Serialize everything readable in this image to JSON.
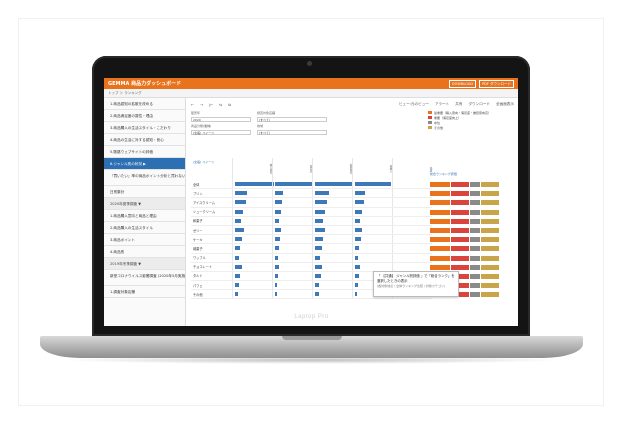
{
  "laptop": {
    "brand": "Laptop Pro"
  },
  "app": {
    "title": "GEMMA 商品力ダッシュボード",
    "buttons": [
      "DOWNLOAD",
      "PDF ダウンロード"
    ],
    "breadcrumb": "トップ ＞ ランキング"
  },
  "sidebar": {
    "items": [
      {
        "label": "1.商品認知の拡散を改める",
        "type": "normal"
      },
      {
        "label": "2.商品満足度の属性・理由",
        "type": "normal"
      },
      {
        "label": "3.商品購入の生活スタイル・こだわり",
        "type": "normal"
      },
      {
        "label": "4.商品の生活に対する認知・良心",
        "type": "normal"
      },
      {
        "label": "5.販路ウェブサイトの評価",
        "type": "normal"
      },
      {
        "label": "6.ジャンル別の状況 ▶",
        "type": "active"
      },
      {
        "label": "『買いたい』率の商品ポイント分析と買わない理由のポイント",
        "type": "tall"
      },
      {
        "label": "日別集計",
        "type": "normal"
      },
      {
        "label": "2020年夏季調査 ▼",
        "type": "section"
      },
      {
        "label": "1.商品購入意向と商品と理由",
        "type": "normal"
      },
      {
        "label": "2.商品購入の生活スタイル",
        "type": "normal"
      },
      {
        "label": "3.商品ポイント",
        "type": "normal"
      },
      {
        "label": "4.商品別",
        "type": "normal"
      },
      {
        "label": "2019年冬季調査 ▼",
        "type": "section"
      },
      {
        "label": "新型コロナウイルス影響調査 (2020年5月実施)",
        "type": "tall"
      },
      {
        "label": "1.調査対象店舗",
        "type": "normal"
      }
    ]
  },
  "toolbar": {
    "left": [
      "←",
      "→",
      "|←",
      "⇆",
      "⧉"
    ],
    "right": [
      "ビュー:元のビュー",
      "アラート",
      "共有",
      "ダウンロード",
      "全画面表示"
    ]
  },
  "filters": [
    {
      "label": "販売年",
      "value": "2020"
    },
    {
      "label": "調査対象店舗",
      "value": "(すべて)"
    },
    {
      "label": "商品分類(業種)",
      "value": "(全般) スイーツ"
    },
    {
      "label": "地域",
      "value": "(すべて)"
    }
  ],
  "legend": [
    {
      "label": "最重要（購入意向・満足度・推奨意向高）",
      "color": "#e8731c"
    },
    {
      "label": "重要（満足度向上）",
      "color": "#d9453d"
    },
    {
      "label": "中位",
      "color": "#8a8a8a"
    },
    {
      "label": "その他",
      "color": "#c9a54a"
    }
  ],
  "grid": {
    "header_label": "(全般) スイーツ",
    "columns": [
      "購入意向",
      "満足度",
      "推奨意向",
      "再購入",
      "価格"
    ],
    "rows": [
      {
        "label": "全体",
        "values": [
          0.95,
          0.9,
          0.92,
          0.88,
          0.0
        ]
      },
      {
        "label": "プリン",
        "values": [
          0.3,
          0.2,
          0.35,
          0.25,
          0.0
        ]
      },
      {
        "label": "アイスクリーム",
        "values": [
          0.28,
          0.18,
          0.3,
          0.22,
          0.0
        ]
      },
      {
        "label": "シュークリーム",
        "values": [
          0.2,
          0.15,
          0.25,
          0.18,
          0.0
        ]
      },
      {
        "label": "和菓子",
        "values": [
          0.15,
          0.1,
          0.2,
          0.12,
          0.0
        ]
      },
      {
        "label": "ゼリー",
        "values": [
          0.22,
          0.14,
          0.24,
          0.16,
          0.0
        ]
      },
      {
        "label": "ケーキ",
        "values": [
          0.18,
          0.12,
          0.2,
          0.14,
          0.0
        ]
      },
      {
        "label": "焼菓子",
        "values": [
          0.12,
          0.1,
          0.16,
          0.1,
          0.0
        ]
      },
      {
        "label": "ワッフル",
        "values": [
          0.1,
          0.08,
          0.12,
          0.08,
          0.0
        ]
      },
      {
        "label": "チョコレート",
        "values": [
          0.16,
          0.1,
          0.18,
          0.12,
          0.0
        ]
      },
      {
        "label": "タルト",
        "values": [
          0.12,
          0.08,
          0.14,
          0.1,
          0.0
        ]
      },
      {
        "label": "パフェ",
        "values": [
          0.1,
          0.06,
          0.1,
          0.08,
          0.0
        ]
      },
      {
        "label": "その他",
        "values": [
          0.08,
          0.05,
          0.09,
          0.06,
          0.0
        ]
      }
    ]
  },
  "scores": {
    "header": "総合ランキング評価",
    "rows": [
      [
        "#e8731c",
        "#d9453d",
        "#8a8a8a",
        "#c9a54a"
      ],
      [
        "#e8731c",
        "#d9453d",
        "#8a8a8a",
        "#c9a54a"
      ],
      [
        "#e8731c",
        "#d9453d",
        "#8a8a8a",
        "#c9a54a"
      ],
      [
        "#e8731c",
        "#d9453d",
        "#8a8a8a",
        "#c9a54a"
      ],
      [
        "#e8731c",
        "#d9453d",
        "#8a8a8a",
        "#c9a54a"
      ],
      [
        "#e8731c",
        "#d9453d",
        "#8a8a8a",
        "#c9a54a"
      ],
      [
        "#e8731c",
        "#d9453d",
        "#8a8a8a",
        "#c9a54a"
      ],
      [
        "#e8731c",
        "#d9453d",
        "#8a8a8a",
        "#c9a54a"
      ],
      [
        "#e8731c",
        "#d9453d",
        "#8a8a8a",
        "#c9a54a"
      ],
      [
        "#e8731c",
        "#d9453d",
        "#8a8a8a",
        "#c9a54a"
      ],
      [
        "#e8731c",
        "#d9453d",
        "#8a8a8a",
        "#c9a54a"
      ],
      [
        "#e8731c",
        "#d9453d",
        "#8a8a8a",
        "#c9a54a"
      ],
      [
        "#e8731c",
        "#d9453d",
        "#8a8a8a",
        "#c9a54a"
      ]
    ]
  },
  "tooltip": {
    "line1": "『 【共通】 ジャンル別評価 』で「総合ランク」を選択したときの表示",
    "line2": "(各対象地点 / 全体ランキング比較 / 対象カテゴリ)"
  }
}
